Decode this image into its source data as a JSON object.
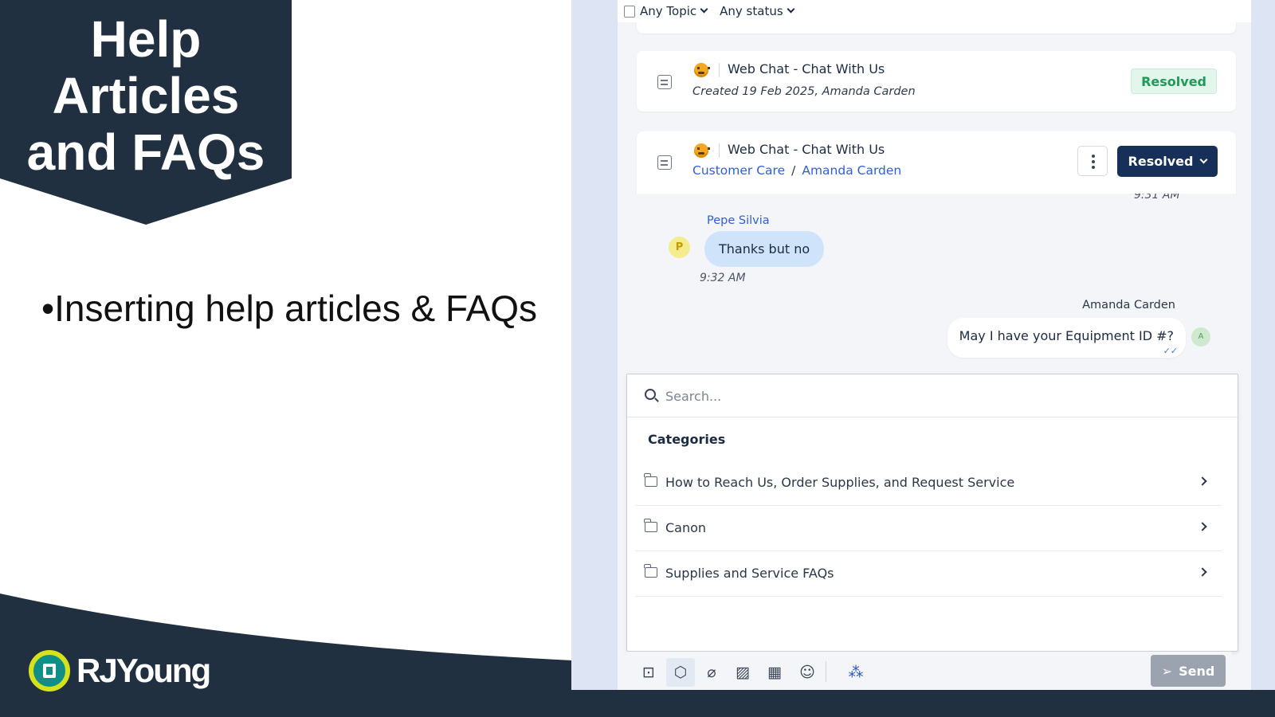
{
  "slide": {
    "title_lines": [
      "Help",
      "Articles",
      "and FAQs"
    ],
    "bullet": "•Inserting help articles & FAQs",
    "logo_text": "RJYoung",
    "colors": {
      "navy": "#213040",
      "logo_ring": "#d7e21e",
      "logo_fill": "#0e8f88"
    }
  },
  "filters": {
    "topic": "Any Topic",
    "status": "Any status"
  },
  "tickets": [
    {
      "channel": "Web Chat - Chat With Us",
      "meta": "Created 19 Feb 2025, Amanda Carden",
      "status_badge": "Resolved"
    },
    {
      "channel": "Web Chat - Chat With Us",
      "breadcrumb": [
        "Customer Care",
        "/",
        "Amanda Carden"
      ],
      "status_button": "Resolved"
    }
  ],
  "chat": {
    "time_top": "9:31 AM",
    "incoming": {
      "sender": "Pepe Silvia",
      "avatar": "P",
      "text": "Thanks but no",
      "time": "9:32 AM"
    },
    "outgoing": {
      "sender": "Amanda Carden",
      "avatar": "A",
      "text": "May I have your Equipment ID #?",
      "read_icon": "double-check-icon"
    }
  },
  "knowledge_base": {
    "search_placeholder": "Search...",
    "heading": "Categories",
    "categories": [
      "How to Reach Us, Order Supplies, and Request Service",
      "Canon",
      "Supplies and Service FAQs"
    ]
  },
  "composer": {
    "tools": [
      "canned-response-icon",
      "knowledge-base-icon",
      "attachment-icon",
      "image-icon",
      "calendar-lock-icon",
      "emoji-icon",
      "ai-assist-icon"
    ],
    "send_label": "Send"
  }
}
